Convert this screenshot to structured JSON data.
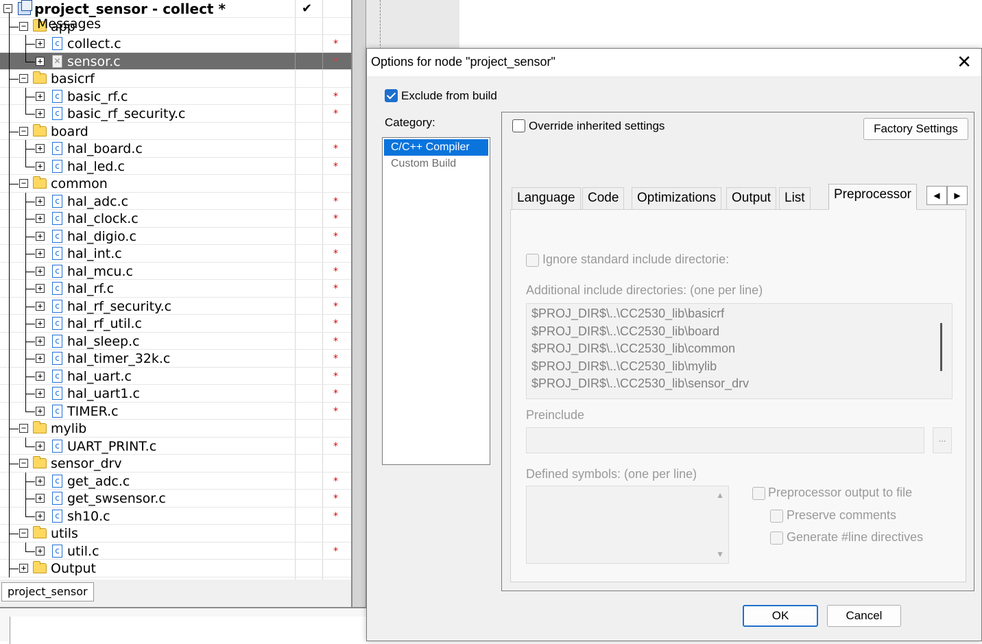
{
  "workspace": {
    "tab_label": "project_sensor",
    "root": {
      "label": "project_sensor - collect *",
      "check": "✔"
    },
    "rows": [
      {
        "type": "folder",
        "label": "app",
        "level": 1,
        "expander": "−"
      },
      {
        "type": "file",
        "label": "collect.c",
        "level": 2,
        "star": "*"
      },
      {
        "type": "file",
        "label": "sensor.c",
        "level": 2,
        "star": "*",
        "selected": true,
        "excluded": true
      },
      {
        "type": "folder",
        "label": "basicrf",
        "level": 1,
        "expander": "−"
      },
      {
        "type": "file",
        "label": "basic_rf.c",
        "level": 2,
        "star": "*"
      },
      {
        "type": "file",
        "label": "basic_rf_security.c",
        "level": 2,
        "star": "*"
      },
      {
        "type": "folder",
        "label": "board",
        "level": 1,
        "expander": "−"
      },
      {
        "type": "file",
        "label": "hal_board.c",
        "level": 2,
        "star": "*"
      },
      {
        "type": "file",
        "label": "hal_led.c",
        "level": 2,
        "star": "*"
      },
      {
        "type": "folder",
        "label": "common",
        "level": 1,
        "expander": "−"
      },
      {
        "type": "file",
        "label": "hal_adc.c",
        "level": 2,
        "star": "*"
      },
      {
        "type": "file",
        "label": "hal_clock.c",
        "level": 2,
        "star": "*"
      },
      {
        "type": "file",
        "label": "hal_digio.c",
        "level": 2,
        "star": "*"
      },
      {
        "type": "file",
        "label": "hal_int.c",
        "level": 2,
        "star": "*"
      },
      {
        "type": "file",
        "label": "hal_mcu.c",
        "level": 2,
        "star": "*"
      },
      {
        "type": "file",
        "label": "hal_rf.c",
        "level": 2,
        "star": "*"
      },
      {
        "type": "file",
        "label": "hal_rf_security.c",
        "level": 2,
        "star": "*"
      },
      {
        "type": "file",
        "label": "hal_rf_util.c",
        "level": 2,
        "star": "*"
      },
      {
        "type": "file",
        "label": "hal_sleep.c",
        "level": 2,
        "star": "*"
      },
      {
        "type": "file",
        "label": "hal_timer_32k.c",
        "level": 2,
        "star": "*"
      },
      {
        "type": "file",
        "label": "hal_uart.c",
        "level": 2,
        "star": "*"
      },
      {
        "type": "file",
        "label": "hal_uart1.c",
        "level": 2,
        "star": "*"
      },
      {
        "type": "file",
        "label": "TIMER.c",
        "level": 2,
        "star": "*"
      },
      {
        "type": "folder",
        "label": "mylib",
        "level": 1,
        "expander": "−"
      },
      {
        "type": "file",
        "label": "UART_PRINT.c",
        "level": 2,
        "star": "*"
      },
      {
        "type": "folder",
        "label": "sensor_drv",
        "level": 1,
        "expander": "−"
      },
      {
        "type": "file",
        "label": "get_adc.c",
        "level": 2,
        "star": "*"
      },
      {
        "type": "file",
        "label": "get_swsensor.c",
        "level": 2,
        "star": "*"
      },
      {
        "type": "file",
        "label": "sh10.c",
        "level": 2,
        "star": "*"
      },
      {
        "type": "folder",
        "label": "utils",
        "level": 1,
        "expander": "−"
      },
      {
        "type": "file",
        "label": "util.c",
        "level": 2,
        "star": "*"
      },
      {
        "type": "folder",
        "label": "Output",
        "level": 1,
        "expander": "+"
      }
    ]
  },
  "messages": {
    "label": "Messages"
  },
  "dialog": {
    "title": "Options for node \"project_sensor\"",
    "close_glyph": "✕",
    "exclude_from_build": {
      "label": "Exclude from build",
      "checked": true
    },
    "category_label": "Category:",
    "categories": [
      {
        "label": "C/C++ Compiler",
        "active": true
      },
      {
        "label": "Custom Build",
        "active": false
      }
    ],
    "override": {
      "label": "Override inherited settings",
      "checked": false
    },
    "factory_settings_label": "Factory Settings",
    "tabs": [
      "Language",
      "Code",
      "Optimizations",
      "Output",
      "List",
      "Preprocessor"
    ],
    "active_tab": "Preprocessor",
    "tab_scroll_left": "◀",
    "tab_scroll_right": "▶",
    "preprocessor": {
      "ignore_std_label": "Ignore standard include directorie:",
      "additional_label": "Additional include directories: (one per line)",
      "include_dirs": [
        "$PROJ_DIR$\\..\\CC2530_lib\\basicrf",
        "$PROJ_DIR$\\..\\CC2530_lib\\board",
        "$PROJ_DIR$\\..\\CC2530_lib\\common",
        "$PROJ_DIR$\\..\\CC2530_lib\\mylib",
        "$PROJ_DIR$\\..\\CC2530_lib\\sensor_drv"
      ],
      "preinclude_label": "Preinclude",
      "preinclude_value": "",
      "browse_label": "...",
      "defined_label": "Defined symbols: (one per line)",
      "defined_value": "",
      "output_to_file_label": "Preprocessor output to file",
      "preserve_comments_label": "Preserve comments",
      "generate_line_label": "Generate #line directives",
      "scroll_up": "▲",
      "scroll_down": "▼"
    },
    "ok_label": "OK",
    "cancel_label": "Cancel"
  },
  "colors": {
    "accent": "#1e70cd",
    "selected_row": "#6d6d6d",
    "star": "#e00000"
  }
}
